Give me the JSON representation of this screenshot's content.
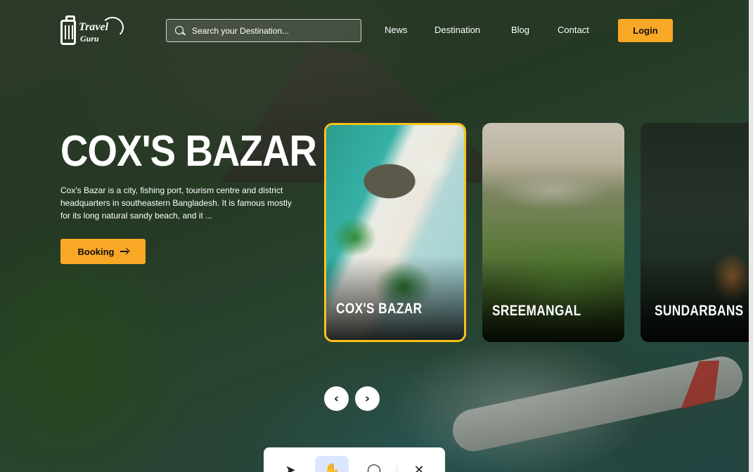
{
  "header": {
    "logo_line1": "Travel",
    "logo_line2": "Guru",
    "search_placeholder": "Search your Destination...",
    "nav": [
      "News",
      "Destination",
      "Blog",
      "Contact"
    ],
    "login_label": "Login"
  },
  "hero": {
    "title": "COX'S BAZAR",
    "description": "Cox's Bazar is a city, fishing port, tourism centre and district headquarters in southeastern Bangladesh. It is famous mostly for its long natural sandy beach, and it ...",
    "booking_label": "Booking"
  },
  "cards": [
    {
      "label": "COX'S BAZAR",
      "active": true
    },
    {
      "label": "SREEMANGAL",
      "active": false
    },
    {
      "label": "SUNDARBANS",
      "active": false
    }
  ],
  "carousel": {
    "prev": "‹",
    "next": "›"
  },
  "toolbar": {
    "tools": [
      {
        "name": "pointer-icon",
        "glyph": "➤"
      },
      {
        "name": "hand-icon",
        "glyph": "✋"
      },
      {
        "name": "comment-icon",
        "glyph": "◯"
      },
      {
        "name": "close-icon",
        "glyph": "✕"
      }
    ]
  },
  "colors": {
    "accent": "#f9a825",
    "card_border": "#f9c21a"
  }
}
